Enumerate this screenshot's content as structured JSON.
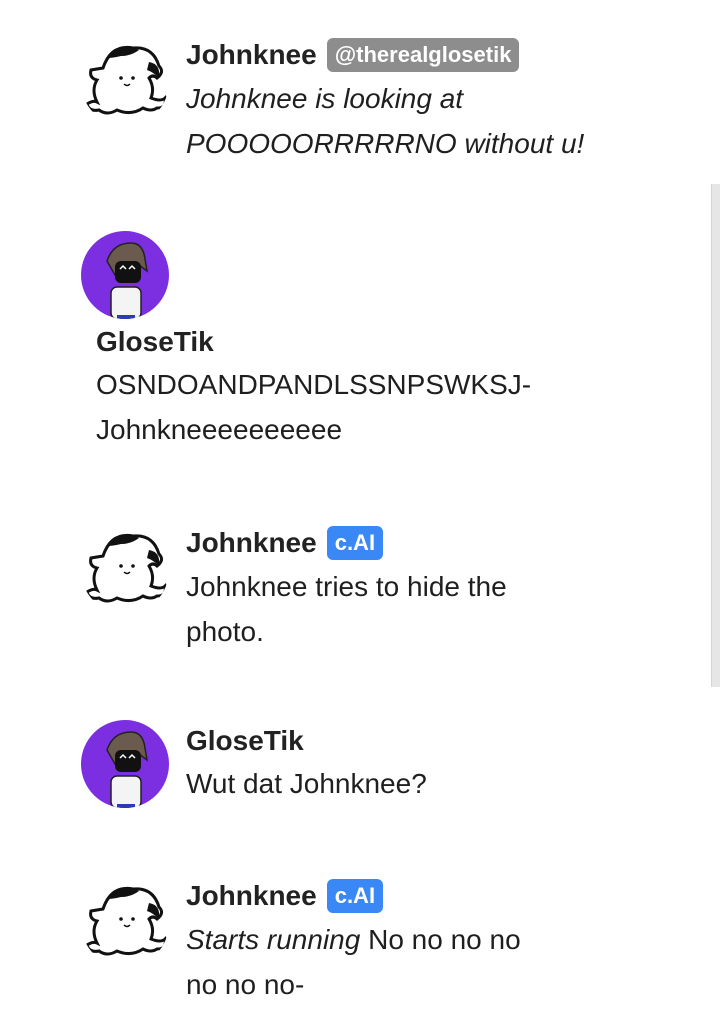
{
  "messages": [
    {
      "author": "Johnknee",
      "badge": "@therealglosetik",
      "text_italic": "Johnknee is looking at POOOOORRRRRNO without u!"
    },
    {
      "author": "GloseTik",
      "text": "OSNDOANDPANDLSSNPSWKSJ- Johnkneeeeeeeeee"
    },
    {
      "author": "Johnknee",
      "badge": "c.AI",
      "text": "Johnknee tries to hide the photo."
    },
    {
      "author": "GloseTik",
      "text": "Wut dat Johnknee?"
    },
    {
      "author": "Johnknee",
      "badge": "c.AI",
      "text_italic": "Starts running",
      "text": " No no no no no no no-"
    }
  ],
  "colors": {
    "handle_badge": "#8d8d8d",
    "cai_badge": "#3a88f5",
    "glosetik_avatar_bg": "#7b2fe0"
  },
  "icons": {
    "johnknee_avatar": "white-cat-avatar-icon",
    "glosetik_avatar": "purple-character-avatar-icon"
  }
}
